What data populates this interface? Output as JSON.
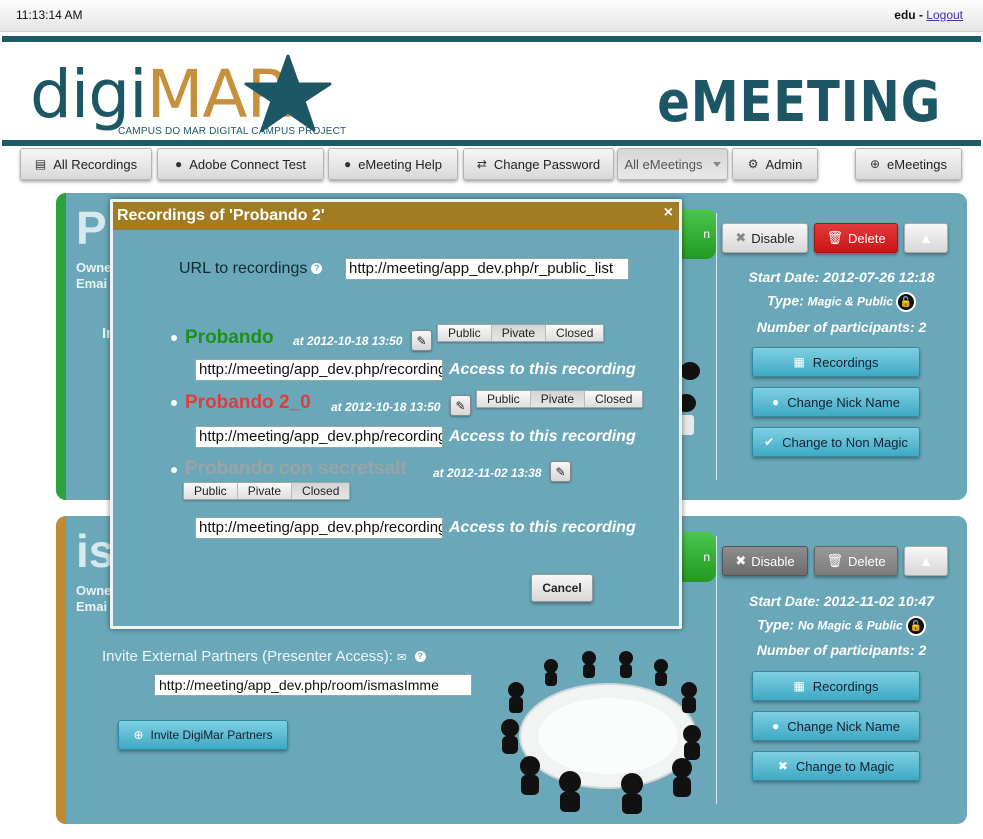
{
  "topbar": {
    "clock": "11:13:14 AM",
    "user": "edu",
    "separator": " - ",
    "logout": "Logout"
  },
  "header": {
    "logo_digi": "digi",
    "logo_mar": "MAR",
    "logo_sub": "CAMPUS DO MAR DIGITAL CAMPUS PROJECT",
    "brand": "eMEETING"
  },
  "nav": {
    "all_recordings": "All Recordings",
    "adobe_test": "Adobe Connect Test",
    "emeeting_help": "eMeeting Help",
    "change_password": "Change Password",
    "all_emeetings": "All eMeetings",
    "admin": "Admin",
    "emeetings": "eMeetings"
  },
  "meeting1": {
    "letter": "P",
    "owner": "Owne",
    "email": "Emai",
    "in": "In",
    "disable": "Disable",
    "delete": "Delete",
    "start_date": "Start Date: 2012-07-26 12:18",
    "type_label": "Type:",
    "type_value": "Magic & Public",
    "participants": "Number of participants: 2",
    "btn_recordings": "Recordings",
    "btn_nick": "Change Nick Name",
    "btn_magic": "Change to Non Magic",
    "green_tail": "n"
  },
  "meeting2": {
    "letter": "is",
    "owner": "Owne",
    "email": "Emai",
    "disable": "Disable",
    "delete": "Delete",
    "start_date": "Start Date: 2012-11-02 10:47",
    "type_label": "Type:",
    "type_value": "No Magic & Public",
    "participants": "Number of participants: 2",
    "btn_recordings": "Recordings",
    "btn_nick": "Change Nick Name",
    "btn_magic": "Change to Magic",
    "invite_label": "Invite External Partners (Presenter Access):",
    "invite_url": "http://meeting/app_dev.php/room/ismasImme",
    "invite_btn": "Invite DigiMar Partners",
    "green_tail": "n"
  },
  "modal": {
    "title": "Recordings of 'Probando 2'",
    "close": "×",
    "url_label": "URL to recordings",
    "url_value": "http://meeting/app_dev.php/r_public_list",
    "access_text": "Access to this recording",
    "cancel": "Cancel",
    "visibility_options": [
      "Public",
      "Pivate",
      "Closed"
    ],
    "recordings": [
      {
        "name": "Probando",
        "date": "at 2012-10-18 13:50",
        "url": "http://meeting/app_dev.php/recording",
        "selected": "Pivate",
        "color": "#1e8f1e"
      },
      {
        "name": "Probando 2_0",
        "date": "at 2012-10-18 13:50",
        "url": "http://meeting/app_dev.php/recording",
        "selected": "Pivate",
        "color": "#e03c3c"
      },
      {
        "name": "Probando con secretsalt",
        "date": "at 2012-11-02 13:38",
        "url": "http://meeting/app_dev.php/recording",
        "selected": "Closed",
        "color": "#9aa4a8"
      }
    ]
  },
  "colors": {
    "teal_dark": "#1d5664",
    "panel": "#6aa8b9",
    "gold": "#c6913c",
    "modal_header": "#a27c22",
    "cyan_button": "#3ea9c4"
  }
}
